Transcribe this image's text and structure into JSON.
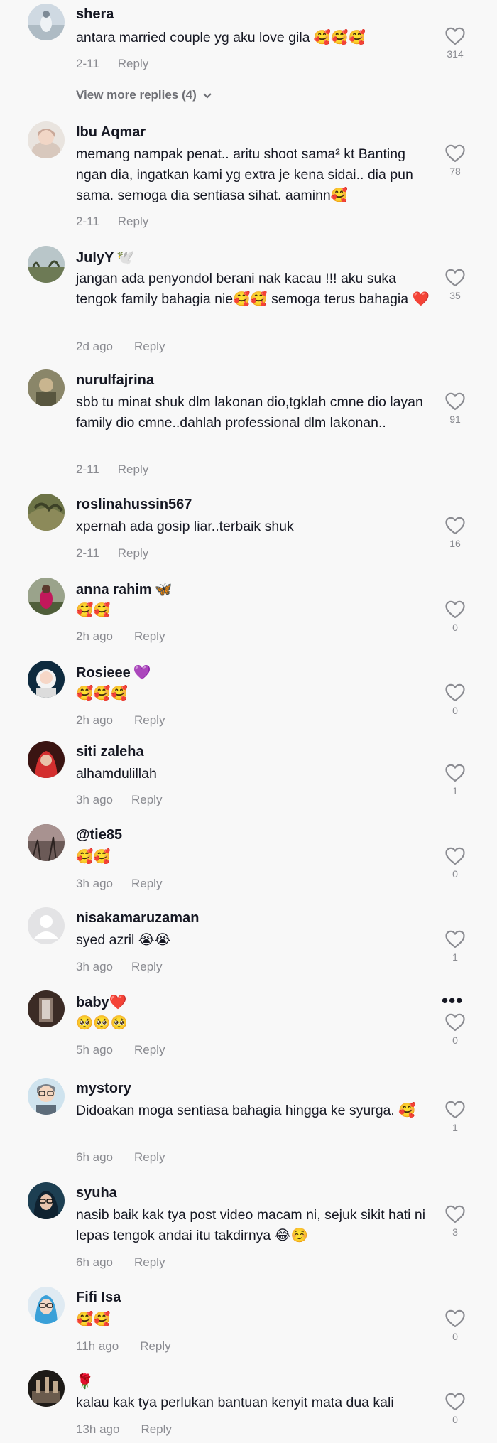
{
  "reply_label": "Reply",
  "view_more": "View more replies (4)",
  "comments": [
    {
      "user": "shera",
      "badge": "",
      "text": "antara married couple yg aku love gila 🥰🥰🥰",
      "time": "2-11",
      "likes": "314"
    },
    {
      "user": "Ibu Aqmar",
      "badge": "",
      "text": "memang nampak penat.. aritu shoot sama² kt Banting ngan dia, ingatkan kami yg extra je kena sidai.. dia pun sama. semoga dia sentiasa sihat. aaminn🥰",
      "time": "2-11",
      "likes": "78"
    },
    {
      "user": "JulyY",
      "badge": "🕊️",
      "text": "jangan ada penyondol berani nak kacau !!! aku suka tengok family bahagia nie🥰🥰 semoga terus bahagia ❤️",
      "time": "2d ago",
      "likes": "35"
    },
    {
      "user": "nurulfajrina",
      "badge": "",
      "text": "sbb tu minat shuk dlm lakonan dio,tgklah cmne dio layan family dio cmne..dahlah professional dlm lakonan..",
      "time": "2-11",
      "likes": "91"
    },
    {
      "user": "roslinahussin567",
      "badge": "",
      "text": "xpernah ada gosip liar..terbaik shuk",
      "time": "2-11",
      "likes": "16"
    },
    {
      "user": "anna rahim",
      "badge": "🦋",
      "text": "🥰🥰",
      "time": "2h ago",
      "likes": "0"
    },
    {
      "user": "Rosieee",
      "badge": "💜",
      "text": "🥰🥰🥰",
      "time": "2h ago",
      "likes": "0"
    },
    {
      "user": "siti zaleha",
      "badge": "",
      "text": "alhamdulillah",
      "time": "3h ago",
      "likes": "1"
    },
    {
      "user": "@tie85",
      "badge": "",
      "text": "🥰🥰",
      "time": "3h ago",
      "likes": "0"
    },
    {
      "user": "nisakamaruzaman",
      "badge": "",
      "text": "syed azril 😭😭",
      "time": "3h ago",
      "likes": "1"
    },
    {
      "user": "baby",
      "badge": "❤️",
      "text": "🥺🥺🥺",
      "time": "5h ago",
      "likes": "0"
    },
    {
      "user": "mystory",
      "badge": "",
      "text": "Didoakan moga sentiasa bahagia hingga ke syurga. 🥰",
      "time": "6h ago",
      "likes": "1"
    },
    {
      "user": "syuha",
      "badge": "",
      "text": "nasib baik kak tya post video macam ni, sejuk sikit hati ni lepas tengok andai itu takdirnya 😂☺️",
      "time": "6h ago",
      "likes": "3"
    },
    {
      "user": "Fifi Isa",
      "badge": "",
      "text": "🥰🥰",
      "time": "11h ago",
      "likes": "0"
    },
    {
      "user": "",
      "badge": "🌹",
      "text": "kalau kak tya perlukan bantuan kenyit mata dua kali",
      "time": "13h ago",
      "likes": "0"
    }
  ],
  "colors": {
    "bg": "#f8f8f8",
    "text": "#161823",
    "muted": "#8a8b91"
  }
}
